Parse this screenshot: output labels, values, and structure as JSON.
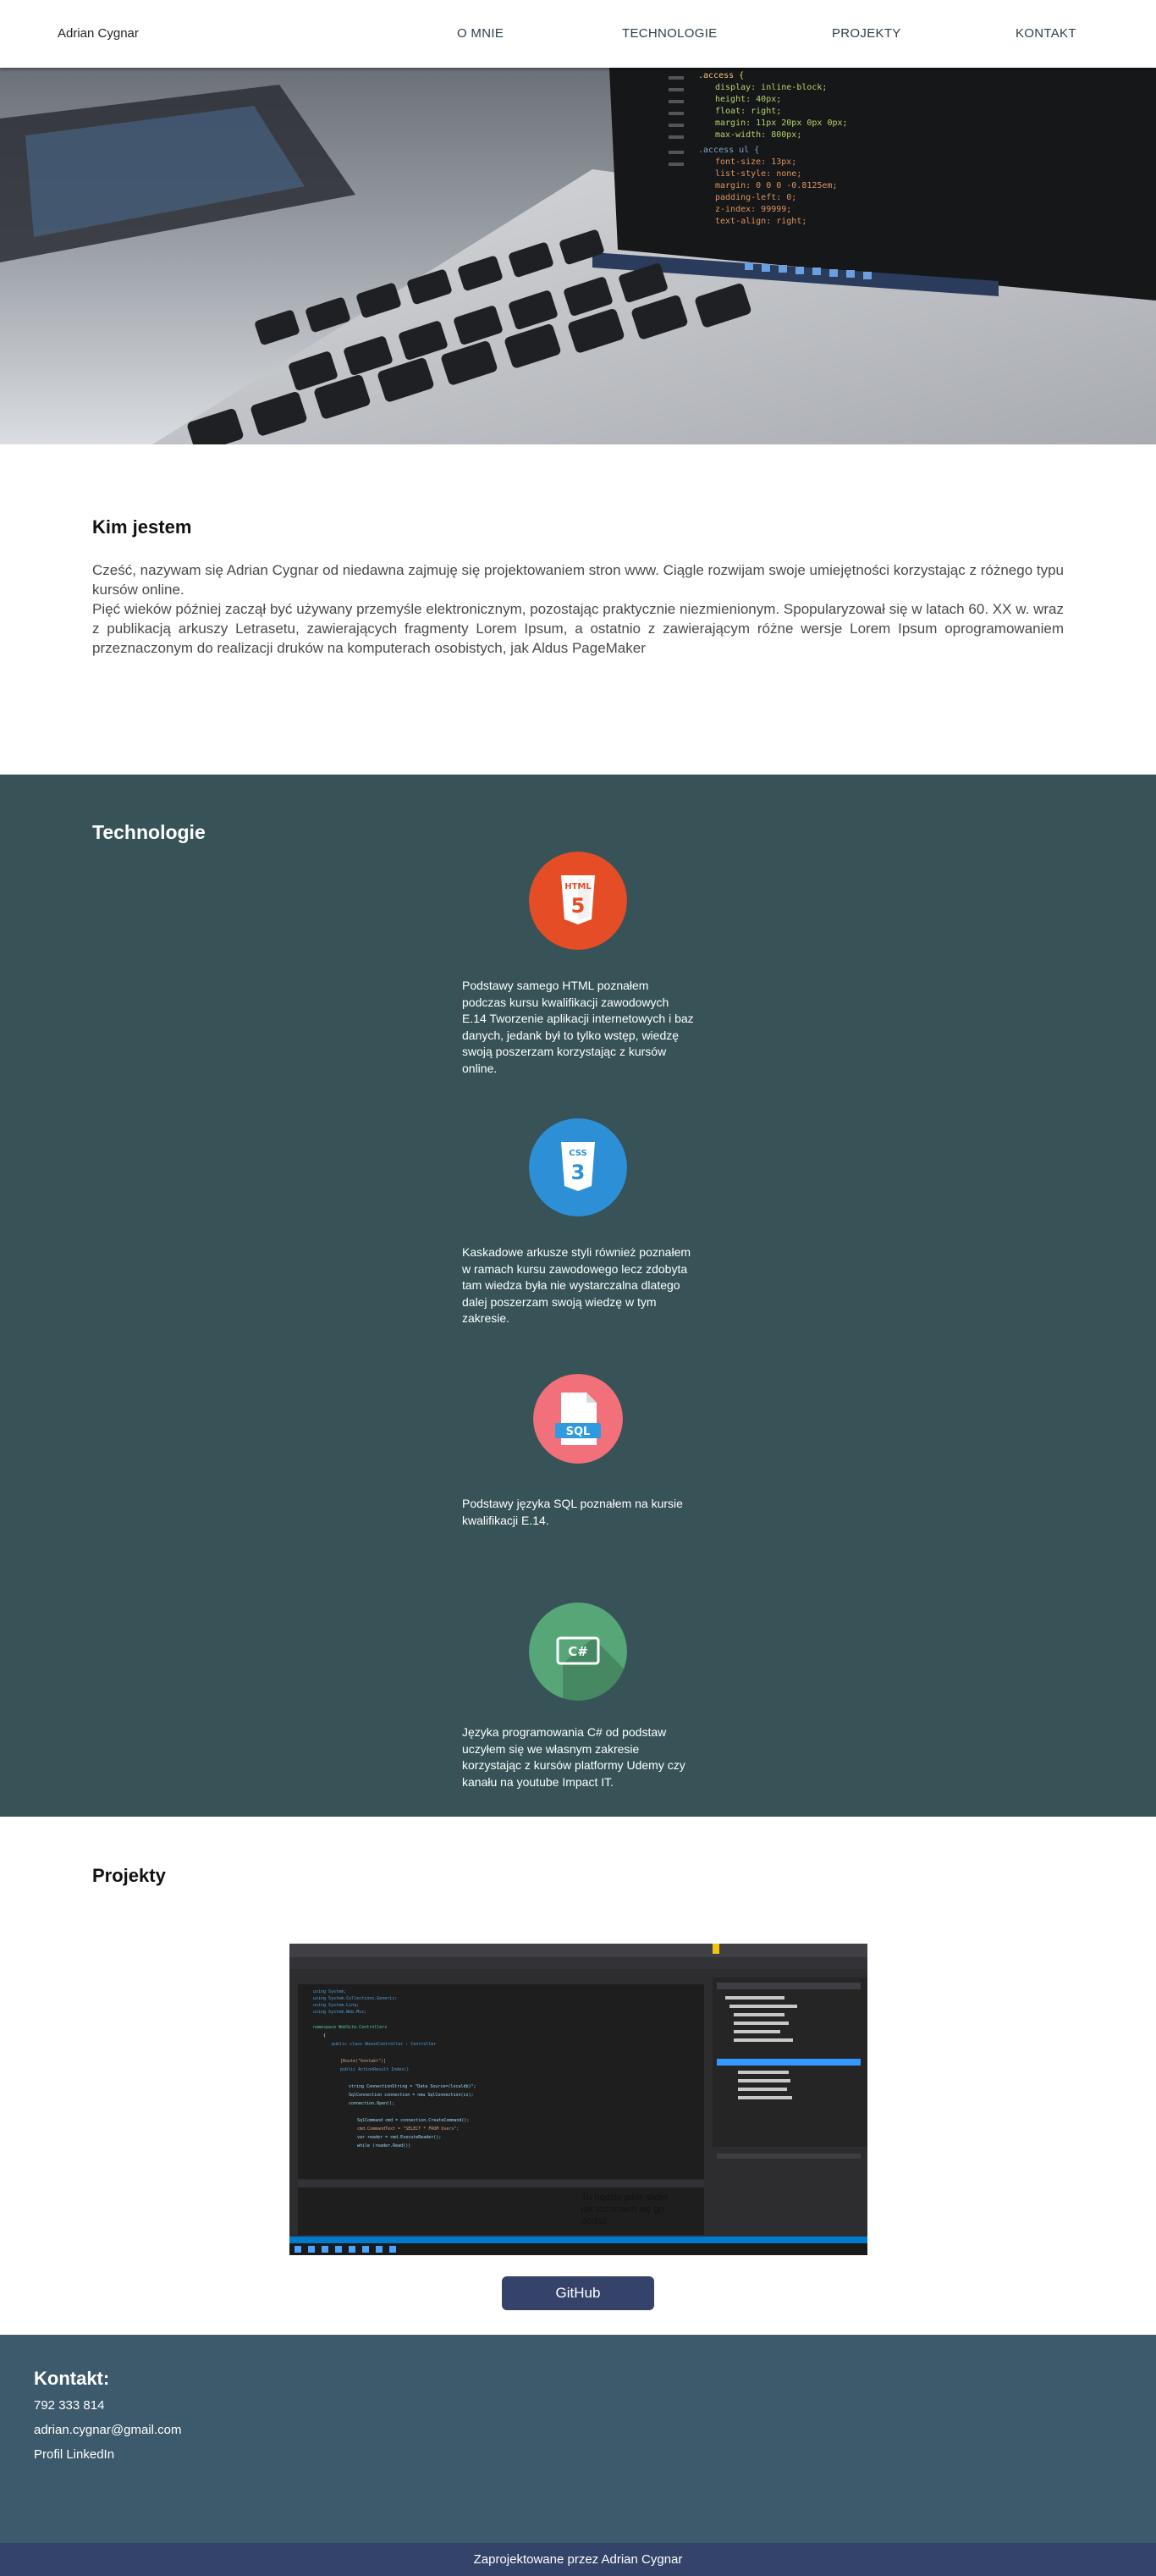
{
  "nav": {
    "brand": "Adrian Cygnar",
    "links": [
      "O MNIE",
      "TECHNOLOGIE",
      "PROJEKTY",
      "KONTAKT"
    ]
  },
  "about": {
    "title": "Kim jestem",
    "text": "Cześć, nazywam się Adrian Cygnar od niedawna zajmuję się projektowaniem stron www. Ciągle rozwijam swoje umiejętności korzystając z różnego typu kursów online.\nPięć wieków później zaczął być używany przemyśle elektronicznym, pozostając praktycznie niezmienionym. Spopularyzował się w latach 60. XX w. wraz z publikacją arkuszy Letrasetu, zawierających fragmenty Lorem Ipsum, a ostatnio z zawierającym różne wersje Lorem Ipsum oprogramowaniem przeznaczonym do realizacji druków na komputerach osobistych, jak Aldus PageMaker"
  },
  "tech": {
    "title": "Technologie",
    "items": [
      {
        "icon": "html5-icon",
        "badge": "HTML",
        "color": "#e44d26",
        "text": "Podstawy samego HTML poznałem podczas kursu kwalifikacji zawodowych E.14 Tworzenie aplikacji internetowych i baz danych, jedank był to tylko wstęp, wiedzę swoją poszerzam korzystając z kursów online."
      },
      {
        "icon": "css3-icon",
        "badge": "CSS",
        "color": "#2d8fd5",
        "text": "Kaskadowe arkusze styli również poznałem w ramach kursu zawodowego lecz zdobyta tam wiedza była nie wystarczalna dlatego dalej poszerzam swoją wiedzę w tym zakresie."
      },
      {
        "icon": "sql-file-icon",
        "badge": "SQL",
        "color": "#f2707a",
        "text": "Podstawy języka SQL poznałem na kursie kwalifikacji E.14."
      },
      {
        "icon": "csharp-icon",
        "badge": "C#",
        "color": "#56a678",
        "text": "Języka programowania C# od podstaw uczyłem się we własnym zakresie korzystając z kursów platformy Udemy czy kanału na youtube Impact IT."
      }
    ]
  },
  "projects": {
    "title": "Projekty",
    "screenshot_caption": "Tu będzie jakiś slider jak rozumiem się go dodać",
    "github_label": "GitHub"
  },
  "contact": {
    "title": "Kontakt:",
    "phone": "792 333 814",
    "email": "adrian.cygnar@gmail.com",
    "linkedin": "Profil LinkedIn"
  },
  "footer": {
    "text": "Zaprojektowane przez Adrian Cygnar"
  }
}
